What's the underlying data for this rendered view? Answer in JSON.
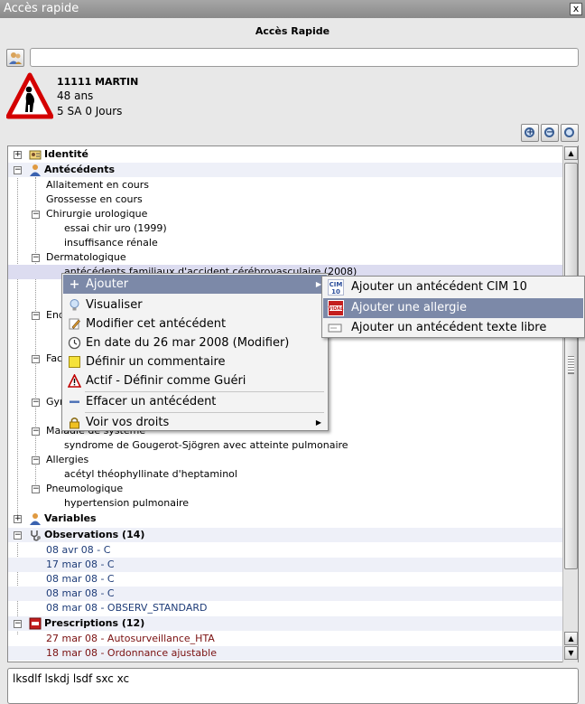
{
  "window": {
    "title": "Accès rapide",
    "close": "x"
  },
  "heading": "Accès Rapide",
  "search": {
    "value": ""
  },
  "patient": {
    "name": "11111 MARTIN",
    "age": "48 ans",
    "term": "5 SA 0 Jours"
  },
  "tree": {
    "identite": "Identité",
    "antecedents": "Antécédents",
    "allaitement": "Allaitement en cours",
    "grossesse": "Grossesse en cours",
    "chirurgie": "Chirurgie urologique",
    "essai": "essai chir uro (1999)",
    "insuffisance": "insuffisance rénale",
    "dermato": "Dermatologique",
    "antecedents_familiaux": "antécédents familiaux d'accident cérébrovasculaire (2008)",
    "endo": "End",
    "fac": "Fac",
    "gyn": "Gyn",
    "maladie": "Maladie de système",
    "gougerot": "syndrome de Gougerot-Sjögren avec atteinte pulmonaire",
    "allergies": "Allergies",
    "acetyl": "acétyl théophyllinate d'heptaminol",
    "pneumo": "Pneumologique",
    "hypertension": "hypertension  pulmonaire",
    "variables": "Variables",
    "observations": "Observations (14)",
    "obs1": "08 avr 08 - C",
    "obs2": "17 mar 08 - C",
    "obs3": "08 mar 08 - C",
    "obs4": "08 mar 08 - C",
    "obs5": "08 mar 08 - OBSERV_STANDARD",
    "prescriptions": "Prescriptions (12)",
    "presc1": "27 mar 08 - Autosurveillance_HTA",
    "presc2": "18 mar 08 - Ordonnance ajustable"
  },
  "context_menu": {
    "ajouter": "Ajouter",
    "visualiser": "Visualiser",
    "modifier": "Modifier cet antécédent",
    "date": "En date du 26 mar 2008 (Modifier)",
    "commentaire": "Définir un commentaire",
    "actif": "Actif - Définir comme Guéri",
    "effacer": "Effacer un antécédent",
    "droits": "Voir vos droits"
  },
  "submenu": {
    "cim10": "Ajouter un antécédent CIM 10",
    "allergie": "Ajouter une allergie",
    "texte_libre": "Ajouter un antécédent texte libre",
    "cim_icon_text": "CIM 10",
    "vidal_icon_text": "VIDAL"
  },
  "notes": {
    "text": "lksdlf lskdj lsdf sxc xc"
  },
  "colors": {
    "highlight": "#7c89a8",
    "selection": "#dcdcf0",
    "blue_text": "#1e3c78",
    "red_text": "#7a1010"
  }
}
